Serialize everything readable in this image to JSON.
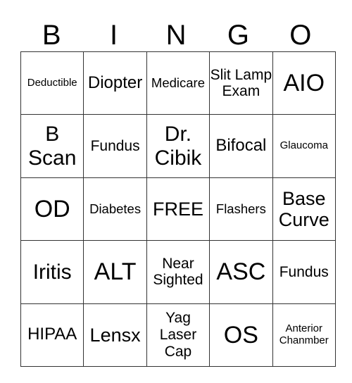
{
  "header": [
    "B",
    "I",
    "N",
    "G",
    "O"
  ],
  "rows": [
    [
      "Deductible",
      "Diopter",
      "Medicare",
      "Slit Lamp Exam",
      "AIO"
    ],
    [
      "B Scan",
      "Fundus",
      "Dr. Cibik",
      "Bifocal",
      "Glaucoma"
    ],
    [
      "OD",
      "Diabetes",
      "FREE",
      "Flashers",
      "Base Curve"
    ],
    [
      "Iritis",
      "ALT",
      "Near Sighted",
      "ASC",
      "Fundus"
    ],
    [
      "HIPAA",
      "Lensx",
      "Yag Laser Cap",
      "OS",
      "Anterior Chanmber"
    ]
  ]
}
